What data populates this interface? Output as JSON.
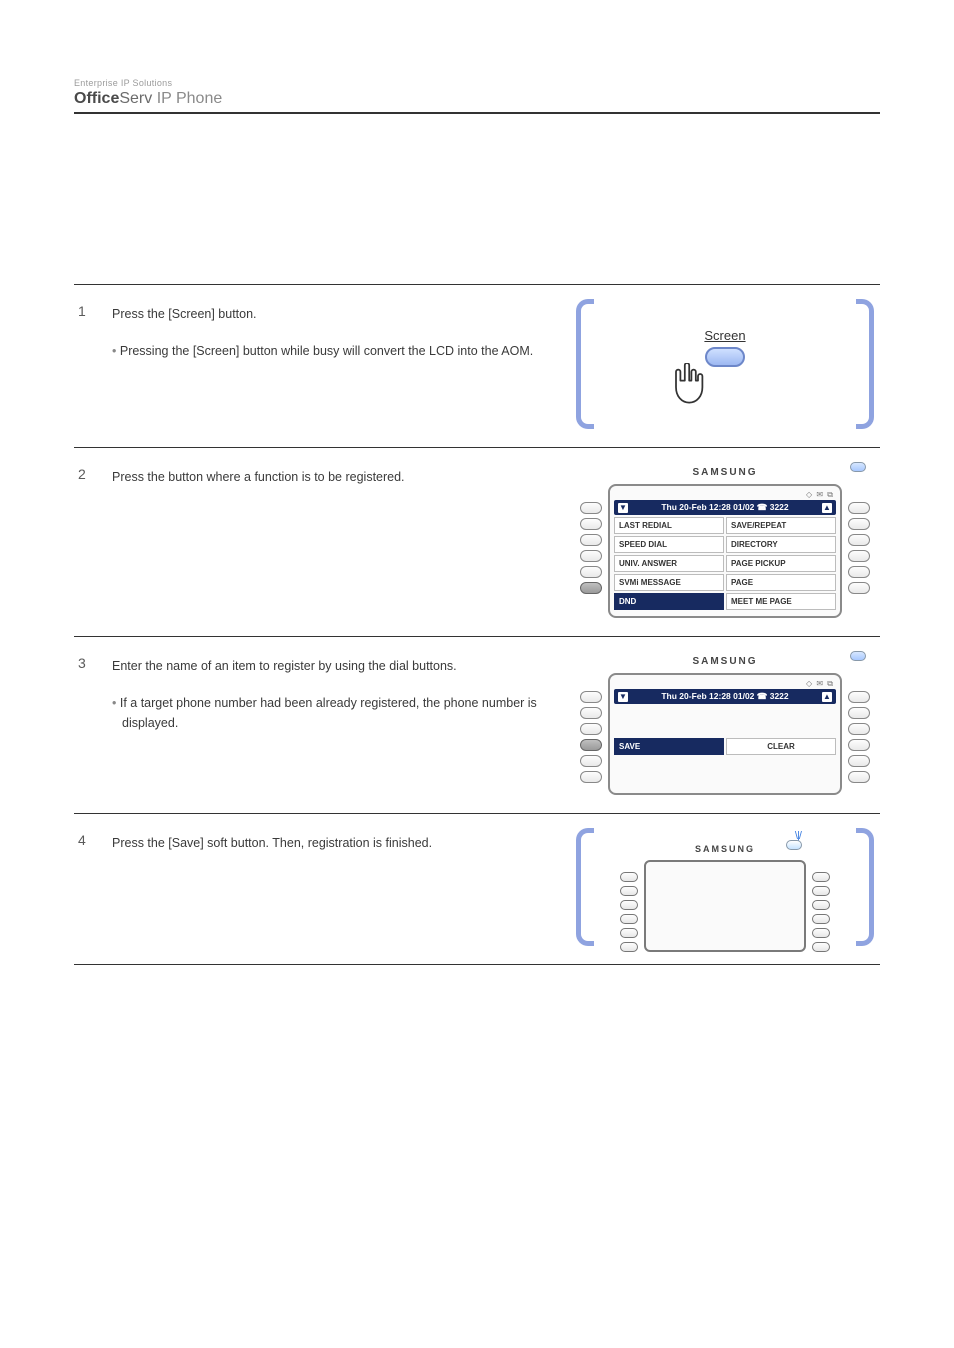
{
  "brand": {
    "tagline": "Enterprise IP Solutions",
    "name_bold": "Office",
    "name_rest": "Serv",
    "suffix": " IP Phone"
  },
  "rows": [
    {
      "num": "1",
      "text": "Press the [Screen] button.",
      "sub": "Pressing the [Screen] button while busy will convert the LCD into the AOM.",
      "illus_label": "Screen"
    },
    {
      "num": "2",
      "text": "Press the button where a function is to be registered.",
      "phone": {
        "samsung": "SAMSUNG",
        "statusbar": "Thu 20-Feb 12:28  01/02 ☎ 3222",
        "hdr_icons": "◇ ✉ ⧉",
        "items_left": [
          "LAST REDIAL",
          "SPEED DIAL",
          "UNIV. ANSWER",
          "SVMi MESSAGE",
          "DND"
        ],
        "items_right": [
          "SAVE/REPEAT",
          "DIRECTORY",
          "PAGE PICKUP",
          "PAGE",
          "MEET ME PAGE"
        ],
        "active_left_index": 4
      }
    },
    {
      "num": "3",
      "text": "Enter the name of an item to register by using the dial buttons.",
      "sub": "If a target phone number had been already registered, the phone number is displayed.",
      "phone": {
        "samsung": "SAMSUNG",
        "statusbar": "Thu 20-Feb 12:28  01/02 ☎ 3222",
        "hdr_icons": "◇ ✉ ⧉",
        "row_labels": [
          "SAVE",
          "CLEAR"
        ],
        "active_left_index": 3
      }
    },
    {
      "num": "4",
      "text": "Press the [Save] soft button. Then, registration is finished.",
      "phone": {
        "samsung": "SAMSUNG"
      }
    }
  ]
}
